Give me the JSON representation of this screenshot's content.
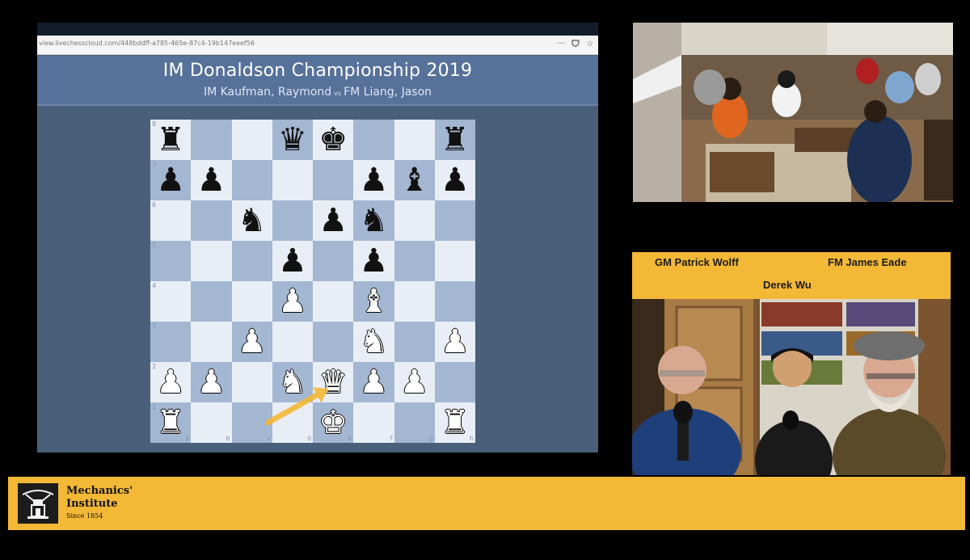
{
  "browser": {
    "url": "view.livechesscloud.com/448bddff-a785-465e-87c4-19b147eeef56",
    "event_title": "IM Donaldson Championship 2019",
    "white_player": "IM Kaufman, Raymond",
    "vs": "vs",
    "black_player": "FM Liang, Jason"
  },
  "board": {
    "files": [
      "a",
      "b",
      "c",
      "d",
      "e",
      "f",
      "g",
      "h"
    ],
    "ranks": [
      "8",
      "7",
      "6",
      "5",
      "4",
      "3",
      "2",
      "1"
    ],
    "pieces": [
      {
        "sq": "a8",
        "color": "black",
        "glyph": "♜",
        "name": "black-rook-icon"
      },
      {
        "sq": "d8",
        "color": "black",
        "glyph": "♛",
        "name": "black-queen-icon"
      },
      {
        "sq": "e8",
        "color": "black",
        "glyph": "♚",
        "name": "black-king-icon"
      },
      {
        "sq": "h8",
        "color": "black",
        "glyph": "♜",
        "name": "black-rook-icon"
      },
      {
        "sq": "a7",
        "color": "black",
        "glyph": "♟",
        "name": "black-pawn-icon"
      },
      {
        "sq": "b7",
        "color": "black",
        "glyph": "♟",
        "name": "black-pawn-icon"
      },
      {
        "sq": "f7",
        "color": "black",
        "glyph": "♟",
        "name": "black-pawn-icon"
      },
      {
        "sq": "g7",
        "color": "black",
        "glyph": "♝",
        "name": "black-bishop-icon"
      },
      {
        "sq": "h7",
        "color": "black",
        "glyph": "♟",
        "name": "black-pawn-icon"
      },
      {
        "sq": "c6",
        "color": "black",
        "glyph": "♞",
        "name": "black-knight-icon"
      },
      {
        "sq": "e6",
        "color": "black",
        "glyph": "♟",
        "name": "black-pawn-icon"
      },
      {
        "sq": "f6",
        "color": "black",
        "glyph": "♞",
        "name": "black-knight-icon"
      },
      {
        "sq": "d5",
        "color": "black",
        "glyph": "♟",
        "name": "black-pawn-icon"
      },
      {
        "sq": "f5",
        "color": "black",
        "glyph": "♟",
        "name": "black-pawn-icon"
      },
      {
        "sq": "d4",
        "color": "white",
        "glyph": "♟",
        "name": "white-pawn-icon"
      },
      {
        "sq": "f4",
        "color": "white",
        "glyph": "♝",
        "name": "white-bishop-icon"
      },
      {
        "sq": "c3",
        "color": "white",
        "glyph": "♟",
        "name": "white-pawn-icon"
      },
      {
        "sq": "f3",
        "color": "white",
        "glyph": "♞",
        "name": "white-knight-icon"
      },
      {
        "sq": "h3",
        "color": "white",
        "glyph": "♟",
        "name": "white-pawn-icon"
      },
      {
        "sq": "a2",
        "color": "white",
        "glyph": "♟",
        "name": "white-pawn-icon"
      },
      {
        "sq": "b2",
        "color": "white",
        "glyph": "♟",
        "name": "white-pawn-icon"
      },
      {
        "sq": "d2",
        "color": "white",
        "glyph": "♞",
        "name": "white-knight-icon"
      },
      {
        "sq": "e2",
        "color": "white",
        "glyph": "♛",
        "name": "white-queen-icon"
      },
      {
        "sq": "f2",
        "color": "white",
        "glyph": "♟",
        "name": "white-pawn-icon"
      },
      {
        "sq": "g2",
        "color": "white",
        "glyph": "♟",
        "name": "white-pawn-icon"
      },
      {
        "sq": "a1",
        "color": "white",
        "glyph": "♜",
        "name": "white-rook-icon"
      },
      {
        "sq": "e1",
        "color": "white",
        "glyph": "♚",
        "name": "white-king-icon"
      },
      {
        "sq": "h1",
        "color": "white",
        "glyph": "♜",
        "name": "white-rook-icon"
      }
    ],
    "arrow": {
      "from": "c1",
      "to": "e2",
      "color": "#f3b836"
    }
  },
  "commentary": {
    "names": {
      "left": "GM Patrick Wolff",
      "right": "FM James Eade",
      "center": "Derek Wu"
    }
  },
  "banner": {
    "org_name": "Mechanics'\nInstitute",
    "since": "Since 1854",
    "logo_icon": "mechanics-institute-logo-icon"
  },
  "colors": {
    "accent_yellow": "#f3b836",
    "header_blue": "#56719a",
    "board_light": "#e9eef6",
    "board_dark": "#a3b7d2"
  }
}
